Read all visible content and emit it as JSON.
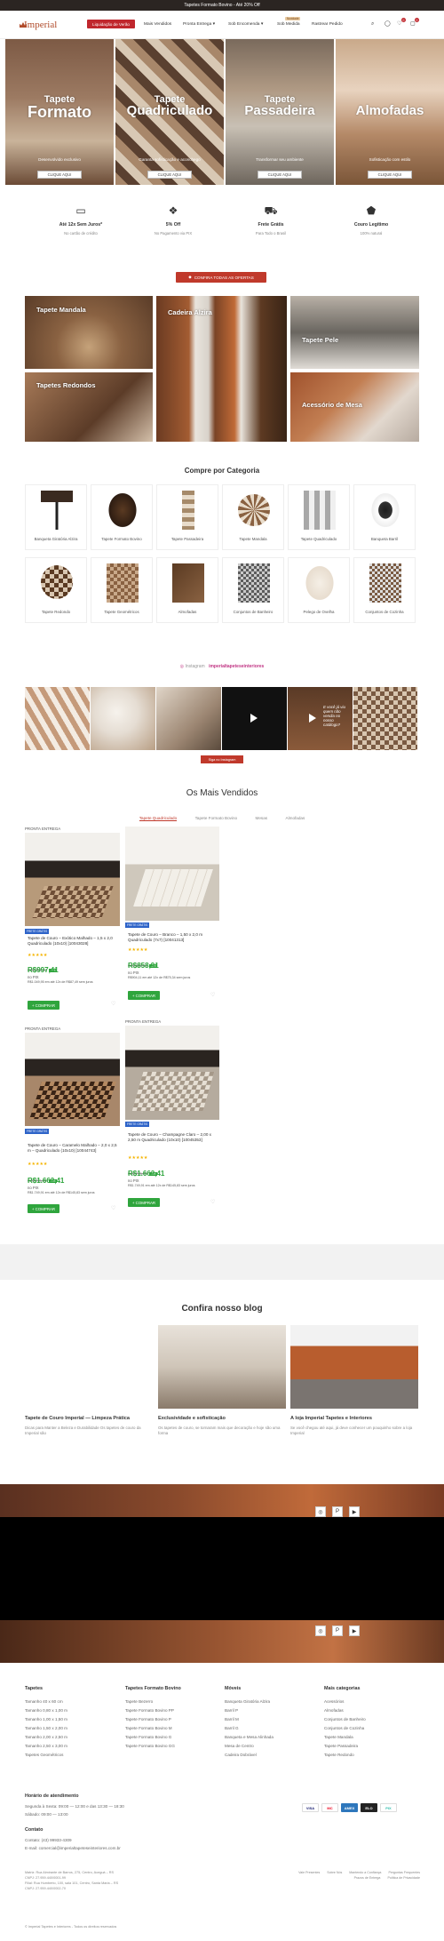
{
  "topbar": {
    "text": "Tapetes Formato Bovino - Até 20% Off"
  },
  "header": {
    "logo_text": "Imperial",
    "promo_button": "Liquidação de Verão",
    "nav": [
      {
        "label": "Mais Vendidos"
      },
      {
        "label": "Pronta Entrega"
      },
      {
        "label": "Sob Encomenda"
      },
      {
        "label": "Sob Medida",
        "badge": "Novidade"
      },
      {
        "label": "Rastrear Pedido"
      }
    ],
    "cart_count": "0",
    "wishlist_count": "0"
  },
  "heroes": [
    {
      "line1": "Tapete",
      "line2": "Formato",
      "sub": "Desenvolvido exclusivo",
      "button": "CLIQUE AQUI"
    },
    {
      "line1": "Tapete",
      "line2": "Quadriculado",
      "sub": "Garanta sofisticação e aconchego",
      "button": "CLIQUE AQUI"
    },
    {
      "line1": "Tapete",
      "line2": "Passadeira",
      "sub": "Transformar seu ambiente",
      "button": "CLIQUE AQUI"
    },
    {
      "line1": "",
      "line2": "Almofadas",
      "sub": "Sofisticação com estilo",
      "button": "CLIQUE AQUI"
    }
  ],
  "features": [
    {
      "icon": "credit-card-icon",
      "title": "Até 12x Sem Juros*",
      "desc": "No cartão de crédito"
    },
    {
      "icon": "diamond-icon",
      "title": "5% Off",
      "desc": "No Pagamento via PIX"
    },
    {
      "icon": "truck-icon",
      "title": "Frete Grátis",
      "desc": "Para Todo o Brasil"
    },
    {
      "icon": "leather-icon",
      "title": "Couro Legítimo",
      "desc": "100% natural"
    }
  ],
  "offers_button": "CONFIRA TODAS AS OFERTAS",
  "tiles": [
    {
      "label": "Tapete Mandala"
    },
    {
      "label": "Cadeira Alzira"
    },
    {
      "label": "Tapete Pele"
    },
    {
      "label": "Tapetes Redondos"
    },
    {
      "label": "Acessório de Mesa"
    }
  ],
  "categories_title": "Compre por Categoria",
  "categories": [
    {
      "label": "Banqueta Giratória Alzira"
    },
    {
      "label": "Tapete Formato Bovino"
    },
    {
      "label": "Tapete Passadeira"
    },
    {
      "label": "Tapete Mandala"
    },
    {
      "label": "Tapete Quadriculado"
    },
    {
      "label": "Banqueta Barril"
    },
    {
      "label": "Tapete Redondo"
    },
    {
      "label": "Tapete Geométricos"
    },
    {
      "label": "Almofadas"
    },
    {
      "label": "Conjuntos de Banheiro"
    },
    {
      "label": "Pelego de Ovelha"
    },
    {
      "label": "Conjuntos de Cozinha"
    }
  ],
  "instagram": {
    "brand": "Instagram",
    "handle": "imperialtapeteseinteriores",
    "follow_button": "Siga no Instagram",
    "post_text": "E você já viu quem não vendia no nosso catálogo?"
  },
  "best_sellers": {
    "title": "Os Mais Vendidos",
    "tabs": [
      "Tapete Quadriculado",
      "Tapete Formato Bovino",
      "Mesas",
      "Almofadas"
    ],
    "products": [
      {
        "tag": "PRONTA ENTREGA",
        "badge": "FRETE GRÁTIS",
        "name": "Tapete de Couro – Exótico Malhado – 1,5 x 2,0 Quadriculado (10x10) [10043028]",
        "old": "R$1.050,00",
        "off": "-5%",
        "price": "R$997,41",
        "pix": "no PIX",
        "inst": "R$1.049,95 em até 12x de R$87,49 sem juros",
        "buy": "+ COMPRAR"
      },
      {
        "tag": "",
        "badge": "FRETE GRÁTIS",
        "name": "Tapete de Couro – Branco – 1,50 x 2,0 m Quadriculado (7x7) [10041313]",
        "old": "R$1.097,93",
        "off": "-5%",
        "price": "R$858,91",
        "pix": "no PIX",
        "inst": "R$904,11 em até 12x de R$75,34 sem juros",
        "buy": "+ COMPRAR"
      },
      {
        "tag": "PRONTA ENTREGA",
        "badge": "FRETE GRÁTIS",
        "name": "Tapete de Couro – Caramelo Malhado – 2,0 x 2,5 m – Quadriculado (10x10) [10044743]",
        "old": "R$1.785,99",
        "off": "-5%",
        "price": "R$1.662,41",
        "pix": "no PIX",
        "inst": "R$1.749,91 em até 12x de R$145,83 sem juros",
        "buy": "+ COMPRAR"
      },
      {
        "tag": "PRONTA ENTREGA",
        "badge": "FRETE GRÁTIS",
        "name": "Tapete de Couro – Champagne Claro – 2,00 x 2,50 m Quadriculado (10x10) [10045353]",
        "old": "R$1.785,99",
        "off": "-5%",
        "price": "R$1.662,41",
        "pix": "no PIX",
        "inst": "R$1.749,91 em até 12x de R$145,83 sem juros",
        "buy": "+ COMPRAR"
      }
    ]
  },
  "blog": {
    "title": "Confira nosso blog",
    "posts": [
      {
        "title": "Tapete de Couro Imperial — Limpeza Prática",
        "excerpt": "Dicas para Manter a Beleza e Durabilidade Os tapetes de couro da Imperial são"
      },
      {
        "title": "Exclusividade e sofisticação",
        "excerpt": "Os tapetes de couro, se tornaram mais que decoração e hoje são uma forma"
      },
      {
        "title": "A loja Imperial Tapetes e Interiores",
        "excerpt": "Se você chegou até aqui, já deve conhecer um pouquinho sobre a loja Imperial"
      }
    ]
  },
  "footer": {
    "columns": [
      {
        "title": "Tapetes",
        "links": [
          "Tamanho 40 x 60 cm",
          "Tamanho 0,80 x 1,00 m",
          "Tamanho 1,00 x 1,50 m",
          "Tamanho 1,50 x 2,00 m",
          "Tamanho 2,00 x 2,50 m",
          "Tamanho 2,50 x 3,00 m",
          "Tapetes Geométricos"
        ]
      },
      {
        "title": "Tapetes Formato Bovino",
        "links": [
          "Tapete Bezerro",
          "Tapete Formato Bovino PP",
          "Tapete Formato Bovino P",
          "Tapete Formato Bovino M",
          "Tapete Formato Bovino G",
          "Tapete Formato Bovino GG"
        ]
      },
      {
        "title": "Móveis",
        "links": [
          "Banqueta Giratória Alzira",
          "Barril P",
          "Barril M",
          "Barril G",
          "Banqueta e Mesa Alinhada",
          "Mesa de Centro",
          "Cadeira Dobrável"
        ]
      },
      {
        "title": "Mais categorias",
        "links": [
          "Acessórios",
          "Almofadas",
          "Conjuntos de Banheiro",
          "Conjuntos de Cozinha",
          "Tapete Mandala",
          "Tapete Passadeira",
          "Tapete Redondo"
        ]
      }
    ],
    "hours_title": "Horário de atendimento",
    "hours": [
      "Segunda à Sexta: 09:00 — 12:00 e das 13:30 — 18:30",
      "Sábado: 09:00 — 13:00"
    ],
    "contact_title": "Contato",
    "contact": [
      "Contato: (43) 99933-4309",
      "E-mail: comercial@imperialtapeteseinteriores.com.br"
    ],
    "address": [
      "Matriz: Rua Almirante de Barros, 275, Centro, Aceguá – RS",
      "CNPJ: 27.959.440/0001-99",
      "Filial: Rua Humberto, 100, sala 101, Centro, Santa Maria – RS",
      "CNPJ: 27.959.440/0002-70"
    ],
    "legal_links": [
      "Vale Presentes",
      "Sobre Nós",
      "Mantendo a Confiança",
      "Perguntas Frequentes",
      "Prazos de Entrega",
      "Política de Privacidade"
    ],
    "payments": [
      "VISA",
      "MC",
      "AMEX",
      "ELO",
      "PIX"
    ],
    "copyright": "© Imperial Tapetes e Interiores - Todos os direitos reservados"
  },
  "colors": {
    "accent": "#c0272d",
    "price": "#2fa53d",
    "brand": "#b04b2a",
    "topbar": "#2b2522"
  }
}
